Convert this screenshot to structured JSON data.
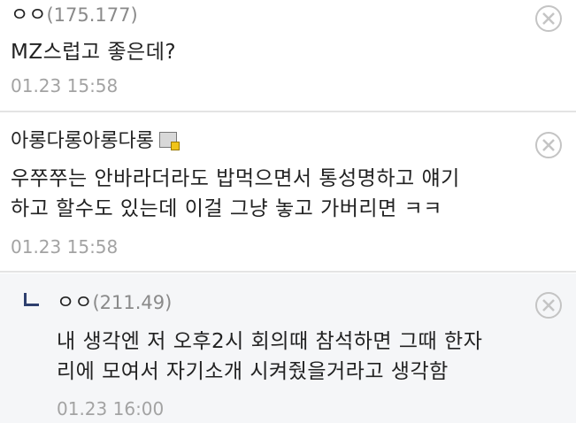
{
  "comments": [
    {
      "author": "ㅇㅇ",
      "ip": "(175.177)",
      "lines": [
        "MZ스럽고 좋은데?"
      ],
      "date": "01.23 15:58"
    },
    {
      "author": "아롱다롱아롱다롱",
      "ip": "",
      "lines": [
        "우쭈쭈는 안바라더라도 밥먹으면서 통성명하고 얘기",
        "하고 할수도 있는데 이걸 그냥 놓고 가버리면 ㅋㅋ"
      ],
      "date": "01.23 15:58"
    },
    {
      "author": "ㅇㅇ",
      "ip": "(211.49)",
      "lines": [
        "내 생각엔 저 오후2시 회의때 참석하면 그때 한자",
        "리에 모여서 자기소개 시켜줬을거라고 생각함"
      ],
      "date": "01.23 16:00"
    }
  ],
  "icons": {
    "delete": "circle-x-icon",
    "member_badge": "gallery-member-badge-icon",
    "reply": "reply-arrow-icon"
  }
}
